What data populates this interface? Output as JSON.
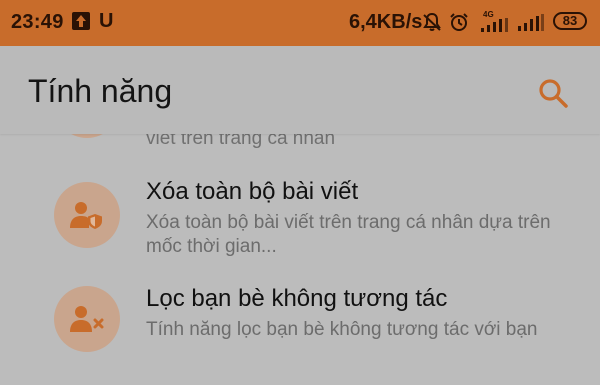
{
  "status_bar": {
    "time": "23:49",
    "carrier_letter": "U",
    "net_speed": "6,4KB/s",
    "network_type": "4G",
    "battery": "83",
    "icons": [
      "upload-icon",
      "mute-icon",
      "alarm-icon",
      "signal-4g-icon",
      "signal-icon"
    ]
  },
  "app_bar": {
    "title": "Tính năng",
    "search_icon": "search-icon"
  },
  "list": {
    "partial_item_desc": "viết trên trang cá nhân",
    "items": [
      {
        "title": "Xóa toàn bộ bài viết",
        "desc": "Xóa toàn bộ bài viết trên trang cá nhân dựa trên mốc thời gian...",
        "icon": "user-shield-icon"
      },
      {
        "title": "Lọc bạn bè không tương tác",
        "desc": "Tính năng lọc bạn bè không tương tác với bạn",
        "icon": "user-remove-icon"
      }
    ]
  },
  "colors": {
    "status_bar": "#c86c2b",
    "accent": "#c86c2b",
    "avatar_bg": "#c9a58d",
    "background": "#bcbcbc"
  }
}
